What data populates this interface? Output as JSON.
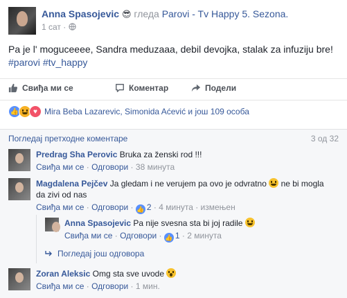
{
  "post": {
    "author": "Anna Spasojevic",
    "feeling_icon": "sunglasses-emoji",
    "feeling_emoticon": "😎",
    "feeling_text": "гледа",
    "target": "Parovi - Tv Happy 5. Sezona.",
    "time": "1 сат",
    "privacy_icon": "globe-icon",
    "text": "Pa je l' moguceeee, Sandra meduzaaa, debil devojka, stalak za infuziju bre!",
    "hashtags": [
      "#parovi",
      "#tv_happy"
    ]
  },
  "actions": {
    "like_label": "Свиђа ми се",
    "comment_label": "Коментар",
    "share_label": "Подели"
  },
  "reactions": {
    "icons": [
      "like-icon",
      "haha-icon",
      "heart-icon"
    ],
    "like_glyph": "👍",
    "heart_glyph": "♥",
    "summary": "Mira Beba Lazarevic, Simonida Aćević и још 109 особа"
  },
  "comments": {
    "previous_label": "Погледај претходне коментаре",
    "count": "3 од 32",
    "items": [
      {
        "author": "Predrag Sha Perovic",
        "text": "Bruka za ženski rod !!!",
        "like": "Свиђа ми се",
        "reply": "Одговори",
        "time": "38 минута"
      },
      {
        "author": "Magdalena Pejčev",
        "text_before": "Ja gledam i ne verujem pa ovo je odvratno",
        "text_after": "ne bi mogla da zivi od nas",
        "like": "Свиђа ми се",
        "reply": "Одговори",
        "likes": "2",
        "time": "4 минута",
        "edited": "измењен",
        "replies": [
          {
            "author": "Anna Spasojevic",
            "text": "Pa nije svesna sta bi joj radile",
            "like": "Свиђа ми се",
            "reply": "Одговори",
            "likes": "1",
            "time": "2 минута"
          }
        ],
        "more_replies_label": "Погледај још одговора"
      },
      {
        "author": "Zoran Aleksic",
        "text": "Omg sta sve uvode",
        "like": "Свиђа ми се",
        "reply": "Одговори",
        "time": "1 мин."
      }
    ]
  },
  "colors": {
    "link": "#365899",
    "meta": "#90949c",
    "comments_bg": "#f6f7f9"
  }
}
